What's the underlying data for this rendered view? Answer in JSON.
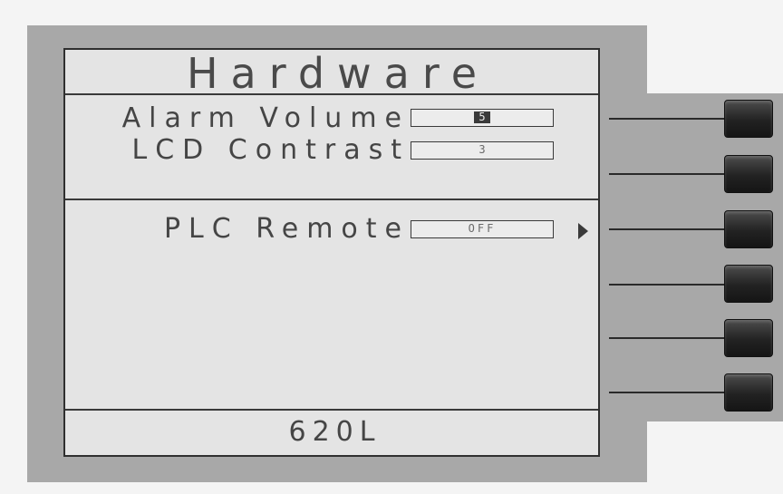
{
  "screen": {
    "title": "Hardware",
    "items": [
      {
        "label": "Alarm Volume",
        "value": "5"
      },
      {
        "label": "LCD Contrast",
        "value": "3"
      },
      {
        "label": "PLC Remote",
        "value": "OFF"
      }
    ],
    "footer": "620L"
  },
  "softkeys": [
    {
      "icon": "softkey-button"
    },
    {
      "icon": "softkey-button"
    },
    {
      "icon": "softkey-button"
    },
    {
      "icon": "softkey-button"
    },
    {
      "icon": "softkey-button"
    },
    {
      "icon": "softkey-button"
    }
  ],
  "colors": {
    "lcd_background": "#e4e4e4",
    "lcd_text": "#4a4a4a",
    "bezel": "#a8a8a8",
    "key": "#222222"
  }
}
